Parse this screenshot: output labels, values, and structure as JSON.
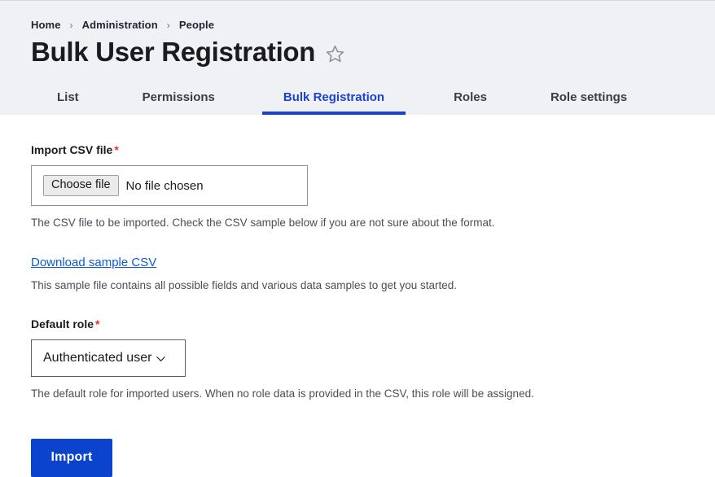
{
  "breadcrumb": {
    "separator": "›",
    "items": [
      {
        "label": "Home"
      },
      {
        "label": "Administration"
      },
      {
        "label": "People"
      }
    ]
  },
  "header": {
    "title": "Bulk User Registration",
    "star_icon": "star-outline-icon"
  },
  "tabs": {
    "items": [
      {
        "label": "List",
        "active": false
      },
      {
        "label": "Permissions",
        "active": false
      },
      {
        "label": "Bulk Registration",
        "active": true
      },
      {
        "label": "Roles",
        "active": false
      },
      {
        "label": "Role settings",
        "active": false
      }
    ]
  },
  "form": {
    "csv": {
      "label": "Import CSV file",
      "required_marker": "*",
      "choose_button": "Choose file",
      "file_status": "No file chosen",
      "description": "The CSV file to be imported. Check the CSV sample below if you are not sure about the format."
    },
    "sample": {
      "link_label": "Download sample CSV",
      "description": "This sample file contains all possible fields and various data samples to get you started."
    },
    "role": {
      "label": "Default role",
      "required_marker": "*",
      "selected": "Authenticated user",
      "options": [
        "Authenticated user"
      ],
      "chevron_icon": "chevron-down-icon",
      "description": "The default role for imported users. When no role data is provided in the CSV, this role will be assigned."
    },
    "submit": {
      "label": "Import"
    }
  },
  "colors": {
    "accent_blue": "#1a42d0",
    "button_blue": "#0b43cc",
    "link_blue": "#0d5bd8",
    "required_red": "#e23030",
    "header_bg": "#f0f1f5"
  }
}
